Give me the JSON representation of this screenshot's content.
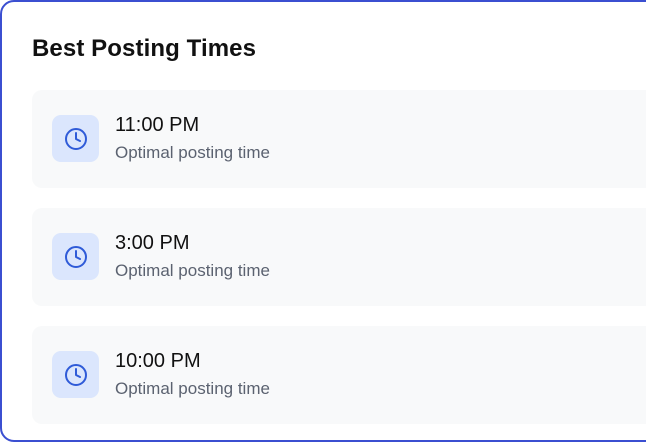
{
  "panel": {
    "title": "Best Posting Times"
  },
  "slots": [
    {
      "time": "11:00 PM",
      "subtitle": "Optimal posting time",
      "icon": "clock-icon"
    },
    {
      "time": "3:00 PM",
      "subtitle": "Optimal posting time",
      "icon": "clock-icon"
    },
    {
      "time": "10:00 PM",
      "subtitle": "Optimal posting time",
      "icon": "clock-icon"
    }
  ],
  "colors": {
    "border": "#3b4fd1",
    "icon_bg": "#dbe6fd",
    "icon_stroke": "#2f5bd8",
    "row_bg": "#f8f9fa"
  }
}
